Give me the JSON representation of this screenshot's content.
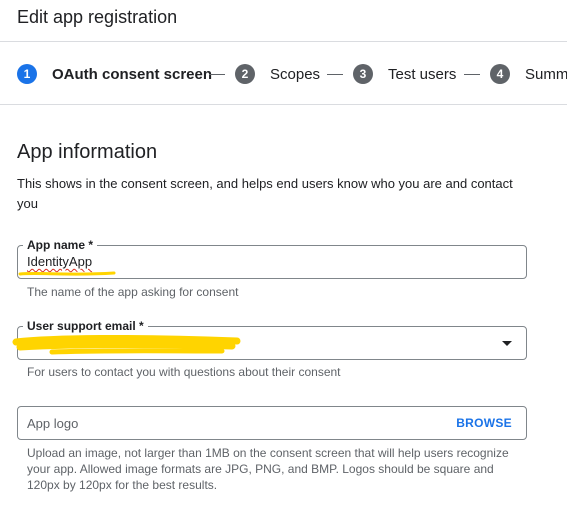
{
  "header": {
    "title": "Edit app registration"
  },
  "stepper": {
    "steps": [
      {
        "number": "1",
        "label": "OAuth consent screen",
        "active": true
      },
      {
        "number": "2",
        "label": "Scopes",
        "active": false
      },
      {
        "number": "3",
        "label": "Test users",
        "active": false
      },
      {
        "number": "4",
        "label": "Summ",
        "active": false
      }
    ]
  },
  "section": {
    "title": "App information",
    "description": "This shows in the consent screen, and helps end users know who you are and contact you"
  },
  "fields": {
    "app_name": {
      "label": "App name *",
      "value": "IdentityApp",
      "help": "The name of the app asking for consent"
    },
    "support_email": {
      "label": "User support email *",
      "value": "",
      "help": "For users to contact you with questions about their consent"
    },
    "app_logo": {
      "placeholder": "App logo",
      "browse_label": "BROWSE",
      "help": "Upload an image, not larger than 1MB on the consent screen that will help users recognize your app. Allowed image formats are JPG, PNG, and BMP. Logos should be square and 120px by 120px for the best results."
    }
  },
  "colors": {
    "accent": "#1a73e8",
    "step_inactive": "#5f6368",
    "highlight": "#ffd400"
  }
}
